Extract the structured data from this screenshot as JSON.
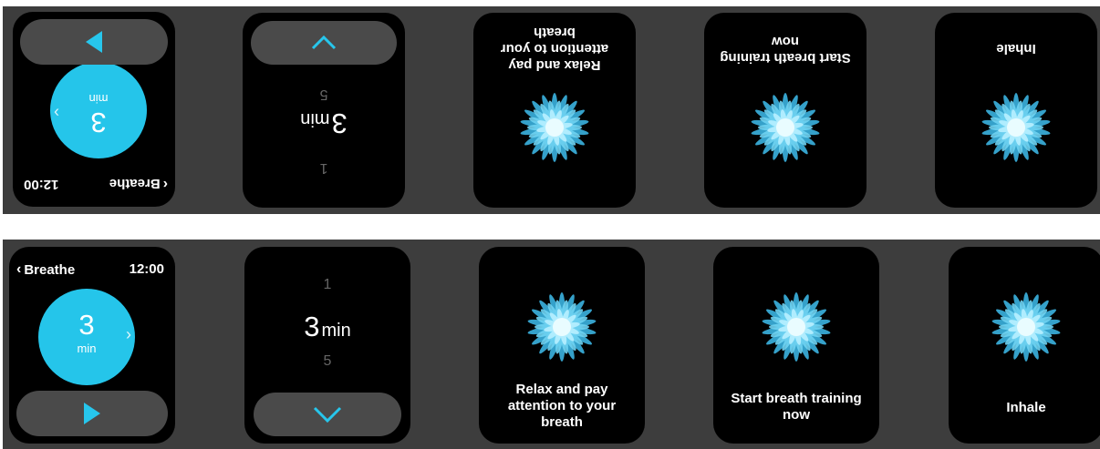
{
  "colors": {
    "accent": "#25c5ea",
    "background": "#3d3d3d",
    "screen": "#000000",
    "pill": "#4a4a4a"
  },
  "status": {
    "back_label": "Breathe",
    "time": "12:00"
  },
  "duration": {
    "value": "3",
    "unit": "min"
  },
  "picker": {
    "prev": "1",
    "current": "3",
    "unit": "min",
    "next": "5"
  },
  "screens": {
    "relax": "Relax and pay attention to your breath",
    "start": "Start breath training now",
    "inhale": "Inhale"
  },
  "icons": {
    "back": "chevron-left-icon",
    "next": "chevron-right-icon",
    "play": "play-icon",
    "up": "chevron-up-icon",
    "confirm": "check-icon",
    "flower": "flower-icon"
  }
}
